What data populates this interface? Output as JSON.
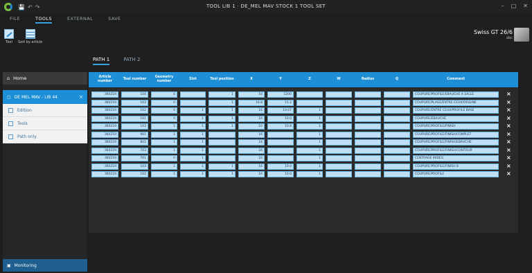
{
  "window": {
    "title": "TOOL LIB 1 · DE_MEL MAV STOCK 1 TOOL SET",
    "quick_access": [
      "💾",
      "↶",
      "↷"
    ],
    "controls": {
      "minimize": "–",
      "maximize": "□",
      "close": "✕"
    }
  },
  "menu": {
    "tabs": [
      "FILE",
      "TOOLS",
      "EXTERNAL",
      "SAVE"
    ],
    "active": "TOOLS"
  },
  "ribbon": {
    "tool_label": "Tool",
    "sort_label": "Sort by article",
    "machine_name": "Swiss GT 26/6",
    "machine_sub": "abc"
  },
  "subtabs": [
    "PATH 1",
    "PATH 2"
  ],
  "sidebar": {
    "home": "Home",
    "machine": "DE MEL MAV - LIB 44",
    "items": [
      "Edition",
      "Tools",
      "Path only"
    ],
    "monitoring": "Monitoring"
  },
  "grid": {
    "columns": [
      "Article number",
      "Tool number",
      "Geometry number",
      "Slot",
      "Tool position",
      "X",
      "Y",
      "Z",
      "W",
      "Radius",
      "Q",
      "Comment"
    ],
    "rows": [
      [
        "360219",
        "104",
        "0",
        "",
        "1",
        "16",
        "1200",
        "",
        "",
        "",
        "",
        "COUPURE/PROFILE/EBAUCHE A SALLE"
      ],
      [
        "360219",
        "103",
        "0",
        "",
        "1",
        "16.8",
        "11.2",
        "",
        "",
        "",
        "",
        "COUPURE/PLAGE/ENTRE CEUX/ORIGINE"
      ],
      [
        "360219",
        "102",
        "0",
        "1",
        "1",
        "16",
        "10.07",
        "1",
        "",
        "",
        "",
        "COUPURE/ENTRE CEUX/PROFILE BASE"
      ],
      [
        "360219",
        "101",
        "0",
        "1",
        "1",
        "16",
        "10.0",
        "1",
        "",
        "",
        "",
        "COUPURE/EBAUCHE"
      ],
      [
        "360219",
        "103",
        "1",
        "1",
        "1",
        "10",
        "10.8",
        "1",
        "",
        "",
        "",
        "COUPURE/PROFILE/FINISH"
      ],
      [
        "360219",
        "901",
        "1",
        "1",
        "",
        "16",
        "",
        "1",
        "",
        "",
        "",
        "COUPURE/PROFILE/FINISH/COMPLET"
      ],
      [
        "360219",
        "801",
        "1",
        "1",
        "",
        "16",
        "",
        "1",
        "",
        "",
        "",
        "COUPURE/PROFILE/FINISH/EBAUCHE"
      ],
      [
        "360219",
        "703",
        "1",
        "1",
        "",
        "16",
        "",
        "1",
        "",
        "",
        "",
        "COUPURE/PROFILE/FINISH/CONTOUR"
      ],
      [
        "360219",
        "701",
        "0",
        "1",
        "",
        "16",
        "",
        "1",
        "",
        "",
        "",
        "CENTRAGE 90DEG"
      ],
      [
        "360219",
        "103",
        "1",
        "1",
        "1",
        "16",
        "10.0",
        "1",
        "",
        "",
        "",
        "COUPURE/PROFILE/FINISH B"
      ],
      [
        "360219",
        "102",
        "1",
        "1",
        "1",
        "16",
        "10.0",
        "1",
        "",
        "",
        "",
        "COUPURE/PROFILE"
      ]
    ]
  },
  "colors": {
    "accent": "#1e8fd6",
    "cell_fill": "#bfe0f4",
    "background": "#1e1e1e"
  },
  "icons": {
    "delete_row": "×",
    "home": "⌂",
    "monitoring": "▣",
    "path": "⏚"
  }
}
